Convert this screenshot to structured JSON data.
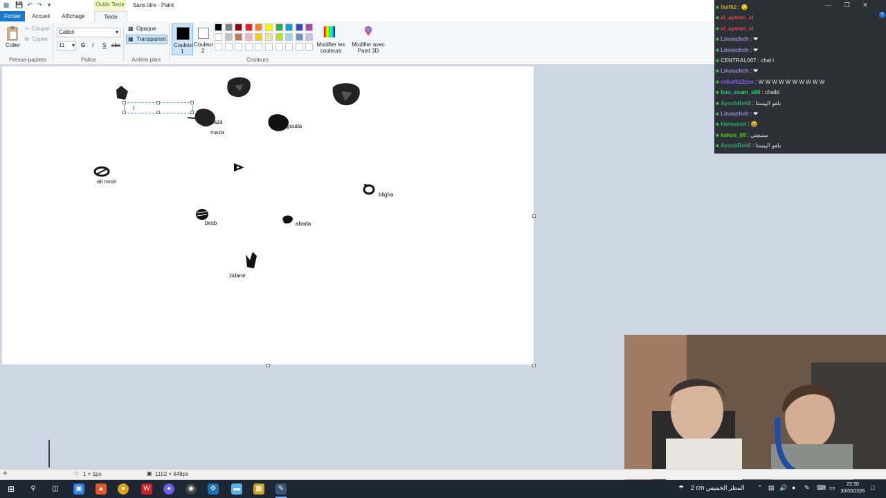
{
  "title_bar": {
    "context_tab": "Outils Texte",
    "app_title": "Sans titre - Paint"
  },
  "tabs": [
    "Fichier",
    "Accueil",
    "Affichage",
    "Texte"
  ],
  "ribbon": {
    "clipboard": {
      "paste": "Coller",
      "cut": "Couper",
      "copy": "Copier",
      "group": "Presse-papiers"
    },
    "font": {
      "family": "Calibri",
      "size": "11",
      "bold": "G",
      "italic": "I",
      "strike": "S",
      "underline": "abc",
      "group": "Police"
    },
    "background": {
      "opaque": "Opaque",
      "transparent": "Transparent",
      "group": "Arrière-plan"
    },
    "colors": {
      "color1_label": "Couleur",
      "color1_num": "1",
      "color2_label": "Couleur",
      "color2_num": "2",
      "edit": "Modifier les couleurs",
      "edit_paint3d": "Modifier avec Paint 3D",
      "group": "Couleurs",
      "color1": "#000000",
      "color2": "#ffffff",
      "palette_row1": [
        "#000000",
        "#7f7f7f",
        "#880015",
        "#ed1c24",
        "#ff7f27",
        "#fff200",
        "#22b14c",
        "#00a2e8",
        "#3f48cc",
        "#a349a4"
      ],
      "palette_row2": [
        "#ffffff",
        "#c3c3c3",
        "#b97a57",
        "#ffaec9",
        "#ffc90e",
        "#efe4b0",
        "#b5e61d",
        "#99d9ea",
        "#7092be",
        "#c8bfe7"
      ]
    }
  },
  "canvas": {
    "labels": {
      "maza_overlap": "maza",
      "maza": "maza",
      "gouda": "gouda",
      "ait_nouri": "ait nouri",
      "bligha": "bligha",
      "besb": "besb",
      "abada": "abada",
      "zidane": "zidane"
    }
  },
  "status": {
    "selection": "1 × 1px",
    "canvas_size": "1152 × 648px"
  },
  "chat": [
    {
      "user": "0ulf62",
      "sep": " : ",
      "msg": "😏",
      "color": "#c9a227"
    },
    {
      "user": "xl_aymen_xl",
      "sep": "",
      "msg": "",
      "color": "#e0484d"
    },
    {
      "user": "xl_aymen_xl",
      "sep": "",
      "msg": "",
      "color": "#e0484d"
    },
    {
      "user": "Linouchch",
      "sep": " : ",
      "msg": "❤",
      "color": "#a389d4"
    },
    {
      "user": "Linouchch",
      "sep": " : ",
      "msg": "❤",
      "color": "#a389d4"
    },
    {
      "user": "CENTRAL007",
      "sep": " : ",
      "msg": "chal i",
      "color": "#b9b9b9"
    },
    {
      "user": "Linouchch",
      "sep": " : ",
      "msg": "❤",
      "color": "#a389d4"
    },
    {
      "user": "nnbafk22pro",
      "sep": " : ",
      "msg": "W W W W W W W W W W",
      "color": "#8b5cf6"
    },
    {
      "user": "hou_ssam_x88",
      "sep": " : ",
      "msg": "chaibi",
      "color": "#2ecc71"
    },
    {
      "user": "AyoubBek8",
      "sep": " : ",
      "msg": "بلفو الپيستا",
      "color": "#38a169"
    },
    {
      "user": "Linouchch",
      "sep": " : ",
      "msg": "❤",
      "color": "#a389d4"
    },
    {
      "user": "khesusxd",
      "sep": " : ",
      "msg": "😄",
      "color": "#27ae60"
    },
    {
      "user": "kakou_88",
      "sep": " : ",
      "msg": "سنيچتي",
      "color": "#5dc41a"
    },
    {
      "user": "AyoubBek8",
      "sep": " : ",
      "msg": "بلفو الپيستا",
      "color": "#38a169"
    }
  ],
  "taskbar": {
    "weather": "2 cm  المطر الخميس",
    "time": "22:30",
    "date": "30/03/2026"
  }
}
